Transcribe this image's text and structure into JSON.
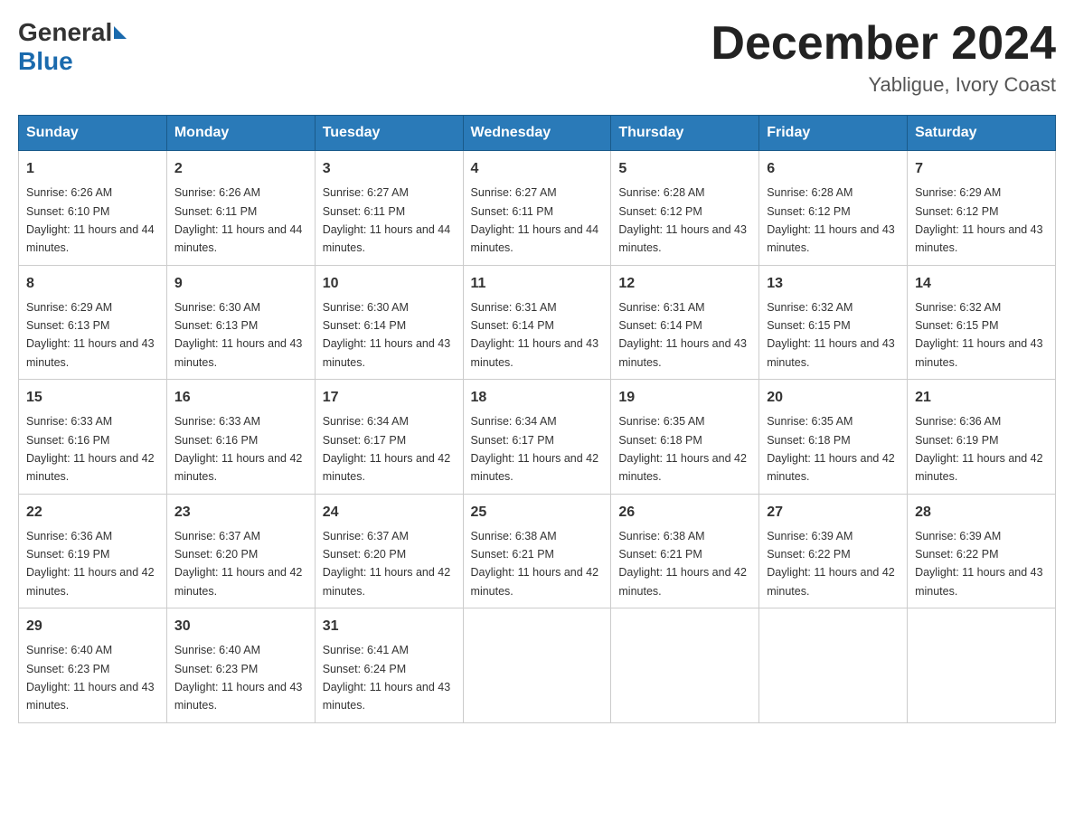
{
  "logo": {
    "general": "General",
    "blue": "Blue"
  },
  "title": "December 2024",
  "subtitle": "Yabligue, Ivory Coast",
  "days": [
    "Sunday",
    "Monday",
    "Tuesday",
    "Wednesday",
    "Thursday",
    "Friday",
    "Saturday"
  ],
  "weeks": [
    [
      {
        "day": "1",
        "sunrise": "6:26 AM",
        "sunset": "6:10 PM",
        "daylight": "11 hours and 44 minutes."
      },
      {
        "day": "2",
        "sunrise": "6:26 AM",
        "sunset": "6:11 PM",
        "daylight": "11 hours and 44 minutes."
      },
      {
        "day": "3",
        "sunrise": "6:27 AM",
        "sunset": "6:11 PM",
        "daylight": "11 hours and 44 minutes."
      },
      {
        "day": "4",
        "sunrise": "6:27 AM",
        "sunset": "6:11 PM",
        "daylight": "11 hours and 44 minutes."
      },
      {
        "day": "5",
        "sunrise": "6:28 AM",
        "sunset": "6:12 PM",
        "daylight": "11 hours and 43 minutes."
      },
      {
        "day": "6",
        "sunrise": "6:28 AM",
        "sunset": "6:12 PM",
        "daylight": "11 hours and 43 minutes."
      },
      {
        "day": "7",
        "sunrise": "6:29 AM",
        "sunset": "6:12 PM",
        "daylight": "11 hours and 43 minutes."
      }
    ],
    [
      {
        "day": "8",
        "sunrise": "6:29 AM",
        "sunset": "6:13 PM",
        "daylight": "11 hours and 43 minutes."
      },
      {
        "day": "9",
        "sunrise": "6:30 AM",
        "sunset": "6:13 PM",
        "daylight": "11 hours and 43 minutes."
      },
      {
        "day": "10",
        "sunrise": "6:30 AM",
        "sunset": "6:14 PM",
        "daylight": "11 hours and 43 minutes."
      },
      {
        "day": "11",
        "sunrise": "6:31 AM",
        "sunset": "6:14 PM",
        "daylight": "11 hours and 43 minutes."
      },
      {
        "day": "12",
        "sunrise": "6:31 AM",
        "sunset": "6:14 PM",
        "daylight": "11 hours and 43 minutes."
      },
      {
        "day": "13",
        "sunrise": "6:32 AM",
        "sunset": "6:15 PM",
        "daylight": "11 hours and 43 minutes."
      },
      {
        "day": "14",
        "sunrise": "6:32 AM",
        "sunset": "6:15 PM",
        "daylight": "11 hours and 43 minutes."
      }
    ],
    [
      {
        "day": "15",
        "sunrise": "6:33 AM",
        "sunset": "6:16 PM",
        "daylight": "11 hours and 42 minutes."
      },
      {
        "day": "16",
        "sunrise": "6:33 AM",
        "sunset": "6:16 PM",
        "daylight": "11 hours and 42 minutes."
      },
      {
        "day": "17",
        "sunrise": "6:34 AM",
        "sunset": "6:17 PM",
        "daylight": "11 hours and 42 minutes."
      },
      {
        "day": "18",
        "sunrise": "6:34 AM",
        "sunset": "6:17 PM",
        "daylight": "11 hours and 42 minutes."
      },
      {
        "day": "19",
        "sunrise": "6:35 AM",
        "sunset": "6:18 PM",
        "daylight": "11 hours and 42 minutes."
      },
      {
        "day": "20",
        "sunrise": "6:35 AM",
        "sunset": "6:18 PM",
        "daylight": "11 hours and 42 minutes."
      },
      {
        "day": "21",
        "sunrise": "6:36 AM",
        "sunset": "6:19 PM",
        "daylight": "11 hours and 42 minutes."
      }
    ],
    [
      {
        "day": "22",
        "sunrise": "6:36 AM",
        "sunset": "6:19 PM",
        "daylight": "11 hours and 42 minutes."
      },
      {
        "day": "23",
        "sunrise": "6:37 AM",
        "sunset": "6:20 PM",
        "daylight": "11 hours and 42 minutes."
      },
      {
        "day": "24",
        "sunrise": "6:37 AM",
        "sunset": "6:20 PM",
        "daylight": "11 hours and 42 minutes."
      },
      {
        "day": "25",
        "sunrise": "6:38 AM",
        "sunset": "6:21 PM",
        "daylight": "11 hours and 42 minutes."
      },
      {
        "day": "26",
        "sunrise": "6:38 AM",
        "sunset": "6:21 PM",
        "daylight": "11 hours and 42 minutes."
      },
      {
        "day": "27",
        "sunrise": "6:39 AM",
        "sunset": "6:22 PM",
        "daylight": "11 hours and 42 minutes."
      },
      {
        "day": "28",
        "sunrise": "6:39 AM",
        "sunset": "6:22 PM",
        "daylight": "11 hours and 43 minutes."
      }
    ],
    [
      {
        "day": "29",
        "sunrise": "6:40 AM",
        "sunset": "6:23 PM",
        "daylight": "11 hours and 43 minutes."
      },
      {
        "day": "30",
        "sunrise": "6:40 AM",
        "sunset": "6:23 PM",
        "daylight": "11 hours and 43 minutes."
      },
      {
        "day": "31",
        "sunrise": "6:41 AM",
        "sunset": "6:24 PM",
        "daylight": "11 hours and 43 minutes."
      },
      null,
      null,
      null,
      null
    ]
  ]
}
